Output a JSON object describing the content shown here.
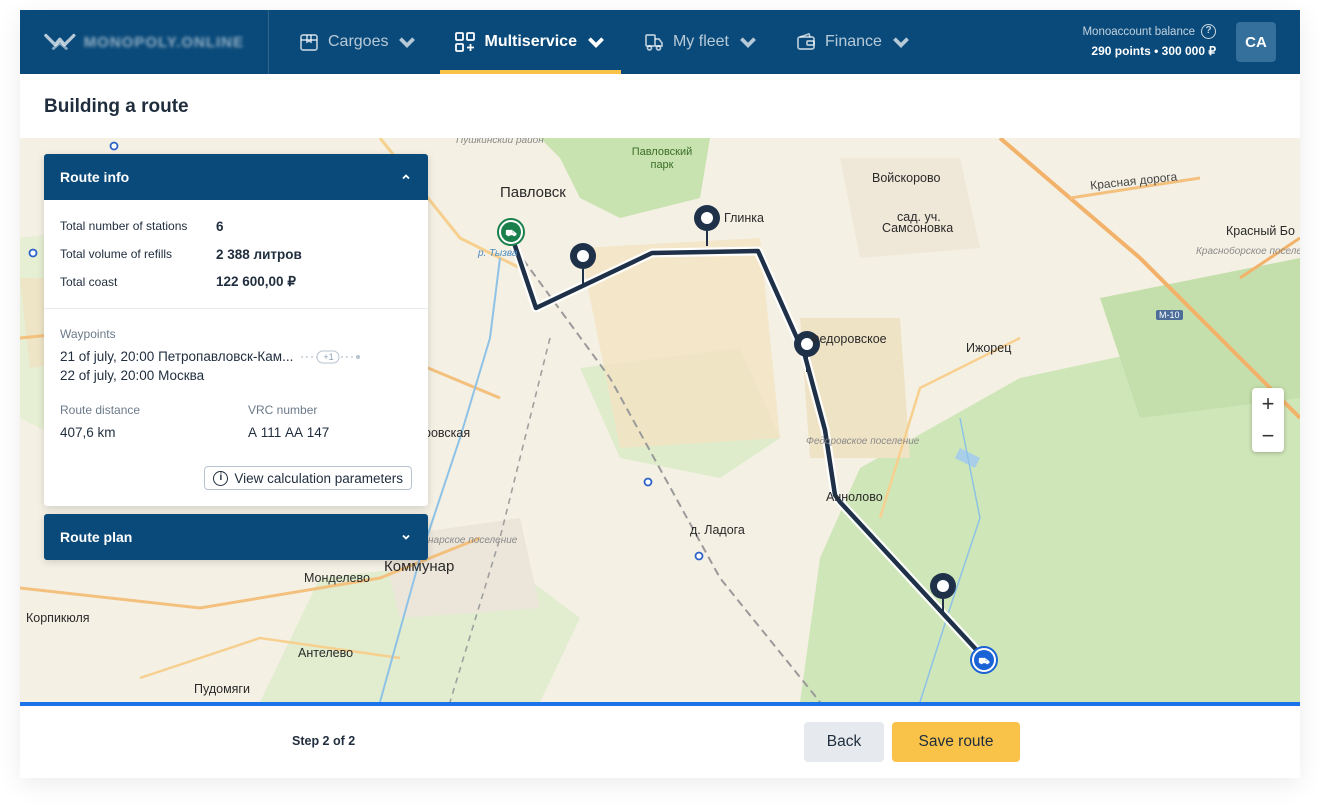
{
  "brand": {
    "logo_text": "MONOPOLY.ONLINE"
  },
  "nav": {
    "items": [
      {
        "label": "Cargoes",
        "icon": "box-icon"
      },
      {
        "label": "Multiservice",
        "icon": "grid-plus-icon",
        "active": true
      },
      {
        "label": "My fleet",
        "icon": "truck-icon"
      },
      {
        "label": "Finance",
        "icon": "wallet-icon"
      }
    ]
  },
  "balance": {
    "label": "Monoaccount balance",
    "value": "290 points • 300 000 ₽"
  },
  "user": {
    "initials": "CA"
  },
  "page": {
    "title": "Building a route"
  },
  "route_info": {
    "title": "Route info",
    "stations_label": "Total number of stations",
    "stations_value": "6",
    "volume_label": "Total volume of refills",
    "volume_value": "2 388 литров",
    "cost_label": "Total coast",
    "cost_value": "122 600,00 ₽",
    "waypoints_label": "Waypoints",
    "waypoint_from": "21 of july, 20:00 Петропавловск-Кам...",
    "waypoint_to": "22 of july, 20:00 Москва",
    "waypoint_extra": "+1",
    "distance_label": "Route distance",
    "distance_value": "407,6 km",
    "vrc_label": "VRC number",
    "vrc_value": "А 111 АА 147",
    "calc_button": "View calculation parameters"
  },
  "route_plan": {
    "title": "Route plan"
  },
  "map": {
    "labels": {
      "pavlovsk": "Павловск",
      "park": "Павловский парк",
      "pushkin": "Пушкинский район",
      "voiskorovo": "Войскорово",
      "glinka": "Глинка",
      "samsonovka1": "сад. уч.",
      "samsonovka2": "Самсоновка",
      "krasnaya": "Красная дорога",
      "krasny_bor": "Красный Бо",
      "krasnoborskoe": "Красноборское поселен",
      "fedorovskoe": "Федоровское",
      "izhorets": "Ижорец",
      "fedorovskoe_pos": "Федоровское поселение",
      "rovskaya": "ровская",
      "aneolovo": "Аннолово",
      "ladoga": "д. Ладога",
      "kommunar_pos": "нарское поселение",
      "kommunar": "Коммунар",
      "mondelevo": "Монделево",
      "korpikyulya": "Корпикюля",
      "antelevo": "Антелево",
      "pudomyagi": "Пудомяги",
      "river": "р. Тызва",
      "m10": "М-10"
    }
  },
  "footer": {
    "step": "Step 2 of 2",
    "back": "Back",
    "save": "Save route"
  },
  "colors": {
    "header": "#0a4a7a",
    "accent": "#f9c349",
    "route": "#1e3149",
    "progress": "#1a73e8"
  }
}
